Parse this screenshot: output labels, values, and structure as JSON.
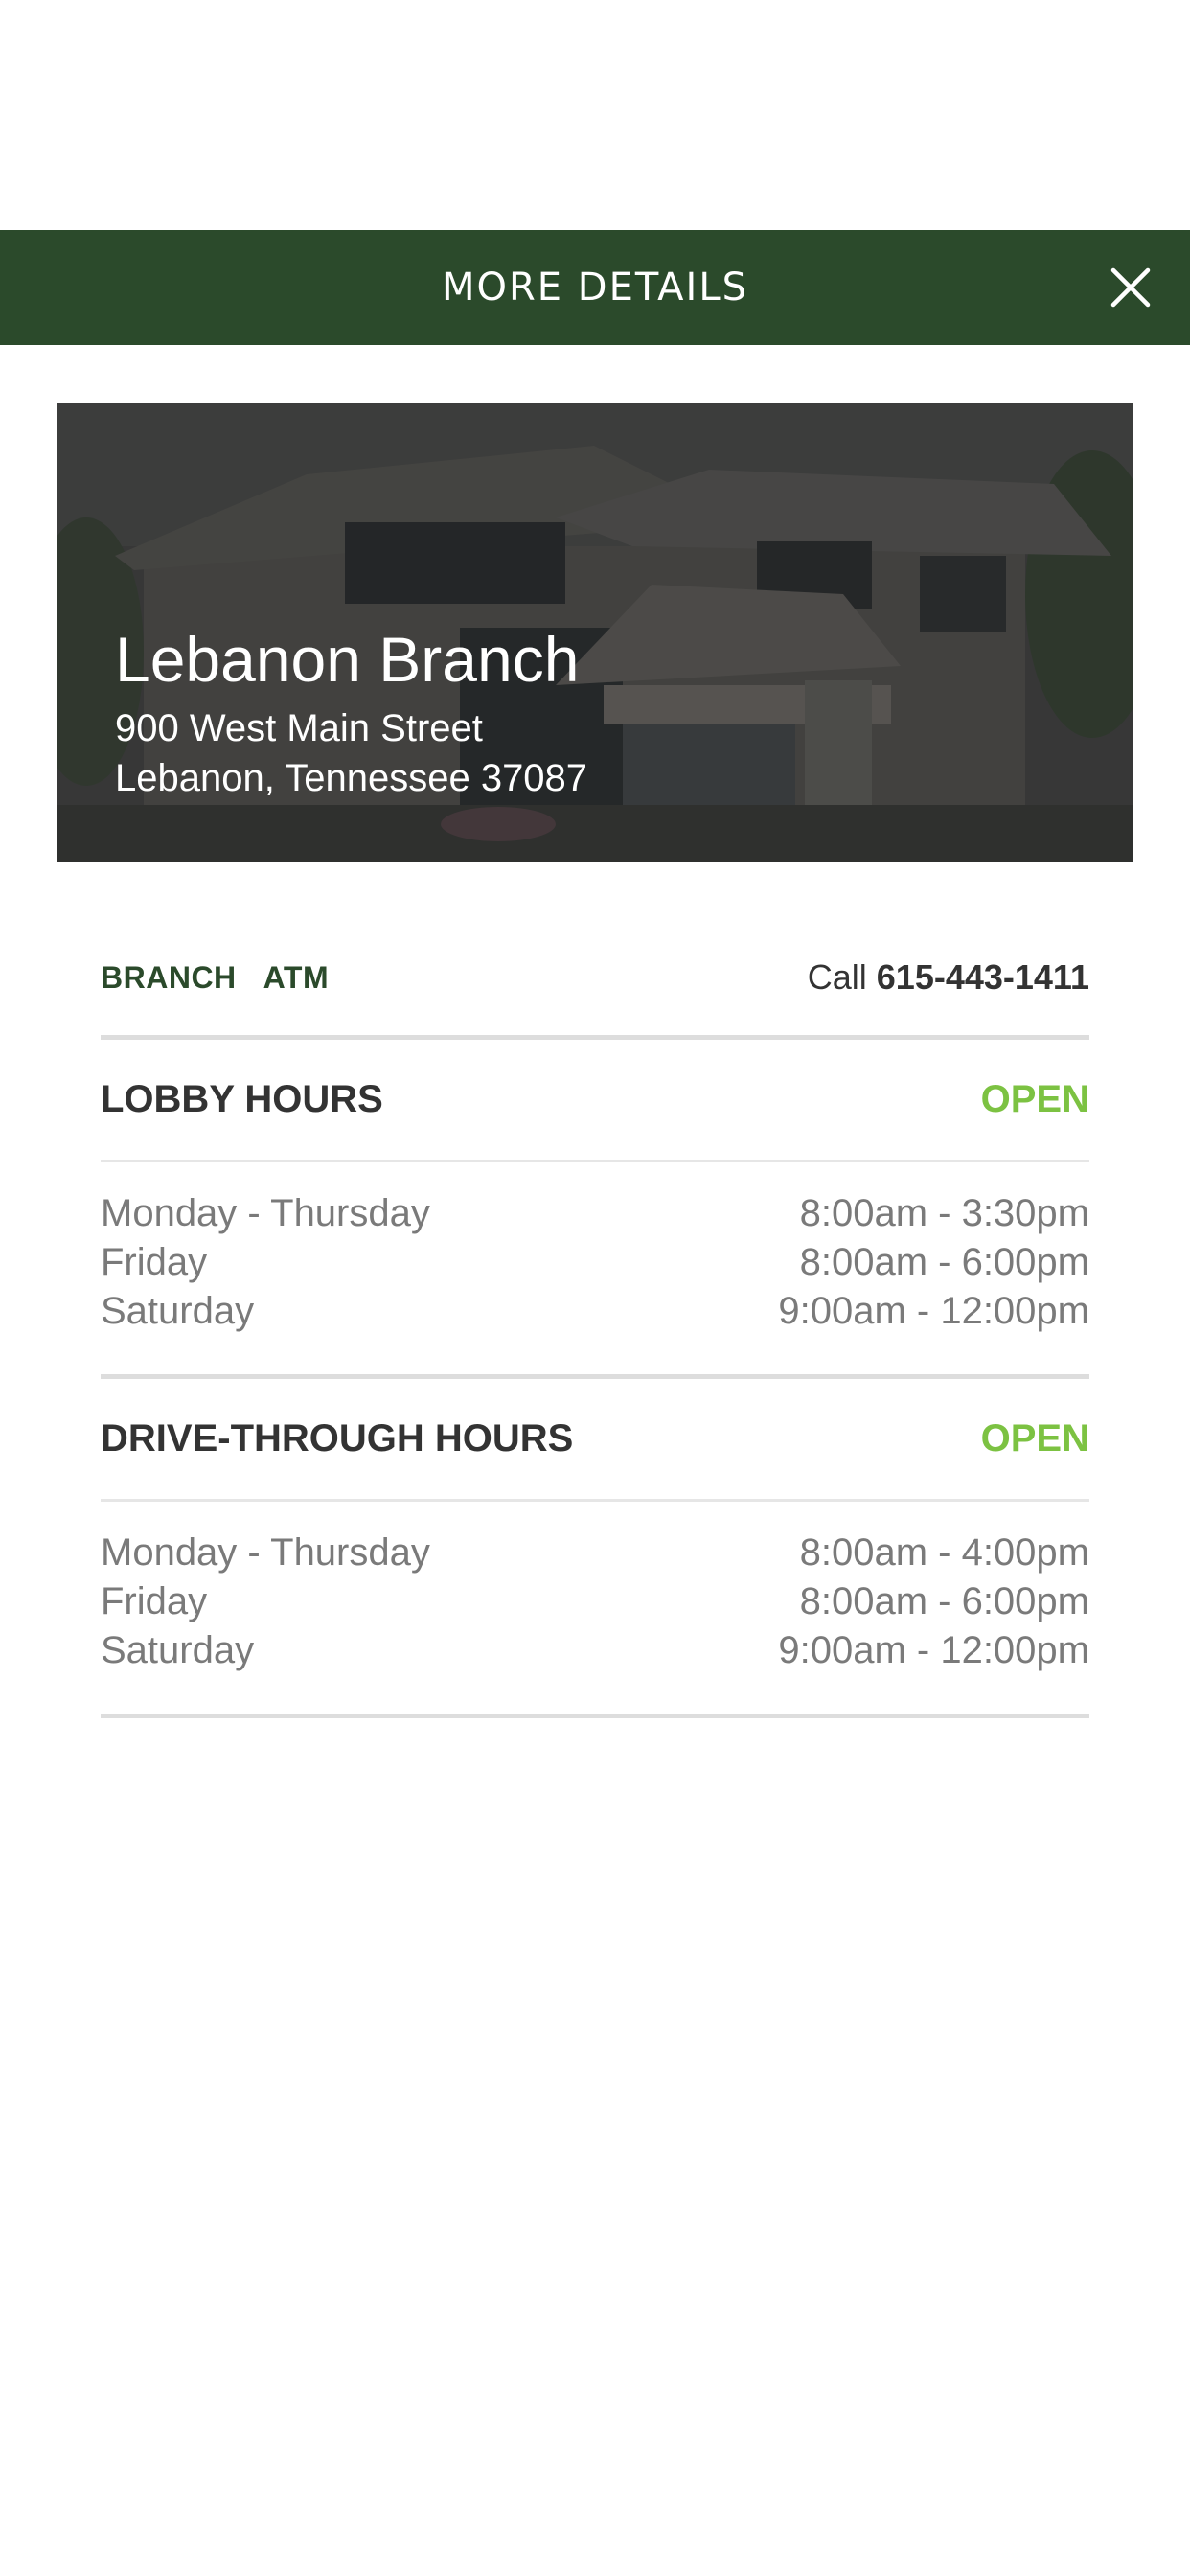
{
  "header": {
    "title": "MORE DETAILS",
    "close_icon": "close-icon"
  },
  "branch": {
    "name": "Lebanon Branch",
    "address_line1": "900 West Main Street",
    "address_line2": "Lebanon, Tennessee 37087"
  },
  "tabs": [
    {
      "label": "BRANCH"
    },
    {
      "label": "ATM"
    }
  ],
  "call": {
    "label": "Call",
    "number": "615-443-1411"
  },
  "lobby": {
    "title": "LOBBY HOURS",
    "status": "OPEN",
    "rows": [
      {
        "day": "Monday - Thursday",
        "time": "8:00am - 3:30pm"
      },
      {
        "day": "Friday",
        "time": "8:00am - 6:00pm"
      },
      {
        "day": "Saturday",
        "time": "9:00am - 12:00pm"
      }
    ]
  },
  "drive": {
    "title": "DRIVE-THROUGH HOURS",
    "status": "OPEN",
    "rows": [
      {
        "day": "Monday - Thursday",
        "time": "8:00am - 4:00pm"
      },
      {
        "day": "Friday",
        "time": "8:00am - 6:00pm"
      },
      {
        "day": "Saturday",
        "time": "9:00am - 12:00pm"
      }
    ]
  },
  "colors": {
    "header_bg": "#2b4a2b",
    "open_green": "#7cc242",
    "tab_green": "#2b4a2b"
  }
}
